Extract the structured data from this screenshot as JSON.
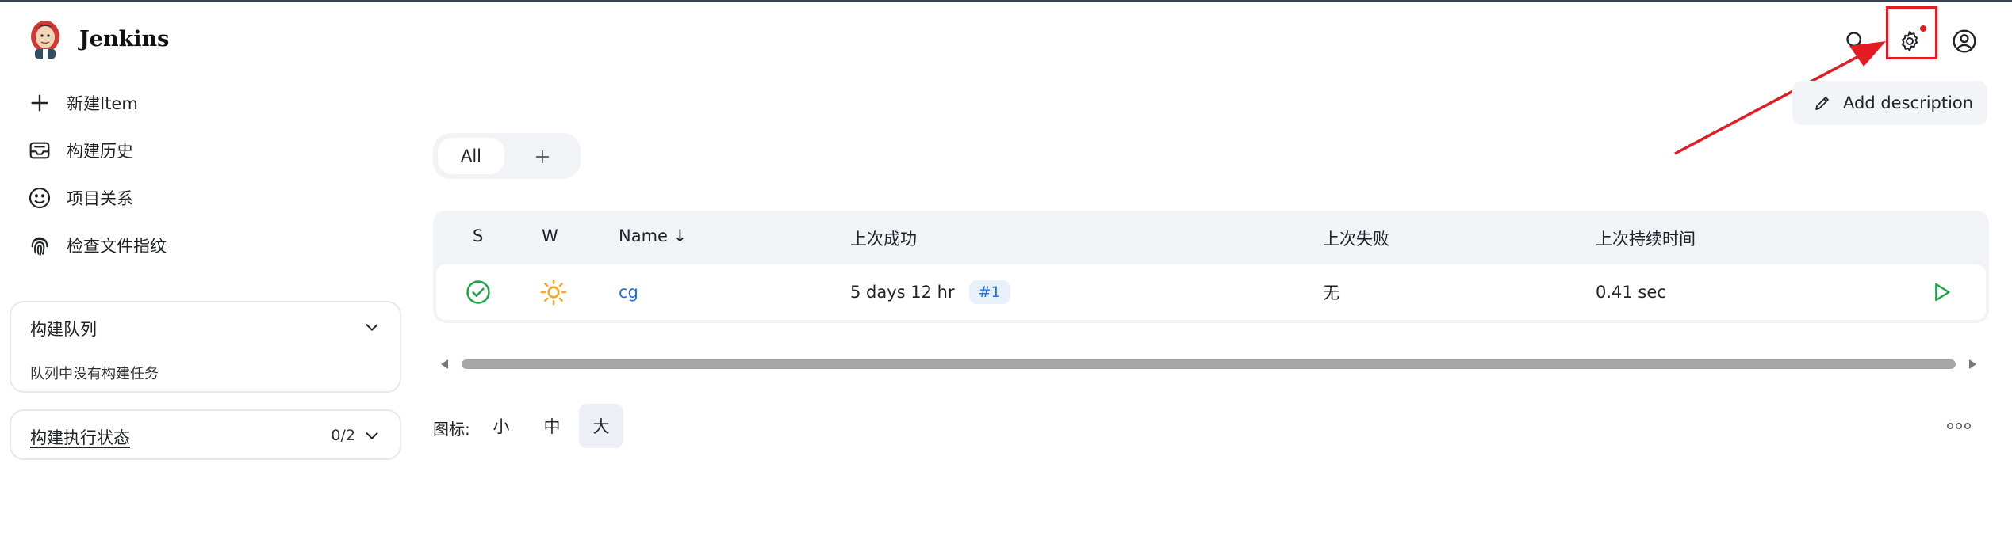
{
  "app": {
    "name": "Jenkins"
  },
  "header": {
    "search_icon": "search-icon",
    "settings_icon": "gear-icon",
    "account_icon": "user-circle-icon",
    "annotation_color": "#e31b23"
  },
  "sidebar": {
    "items": [
      {
        "label": "新建Item",
        "icon": "plus-icon"
      },
      {
        "label": "构建历史",
        "icon": "inbox-icon"
      },
      {
        "label": "项目关系",
        "icon": "relationship-icon"
      },
      {
        "label": "检查文件指纹",
        "icon": "fingerprint-icon"
      }
    ],
    "queue": {
      "title": "构建队列",
      "empty": "队列中没有构建任务"
    },
    "executors": {
      "title": "构建执行状态",
      "count": "0/2"
    }
  },
  "main": {
    "add_description": "Add description",
    "tabs": [
      {
        "label": "All"
      }
    ],
    "add_tab_label": "+",
    "table": {
      "headers": {
        "s": "S",
        "w": "W",
        "name": "Name ↓",
        "last_success": "上次成功",
        "last_failure": "上次失败",
        "last_duration": "上次持续时间"
      },
      "rows": [
        {
          "status": "success",
          "weather": "sunny",
          "name": "cg",
          "last_success": "5 days 12 hr",
          "build": "#1",
          "last_failure": "无",
          "last_duration": "0.41 sec"
        }
      ]
    },
    "icon_size": {
      "label": "图标:",
      "small": "小",
      "medium": "中",
      "large": "大",
      "selected": "大"
    },
    "more": "..."
  },
  "colors": {
    "accent": "#1f6fd8",
    "success": "#1ea446",
    "sun": "#f5a623"
  }
}
